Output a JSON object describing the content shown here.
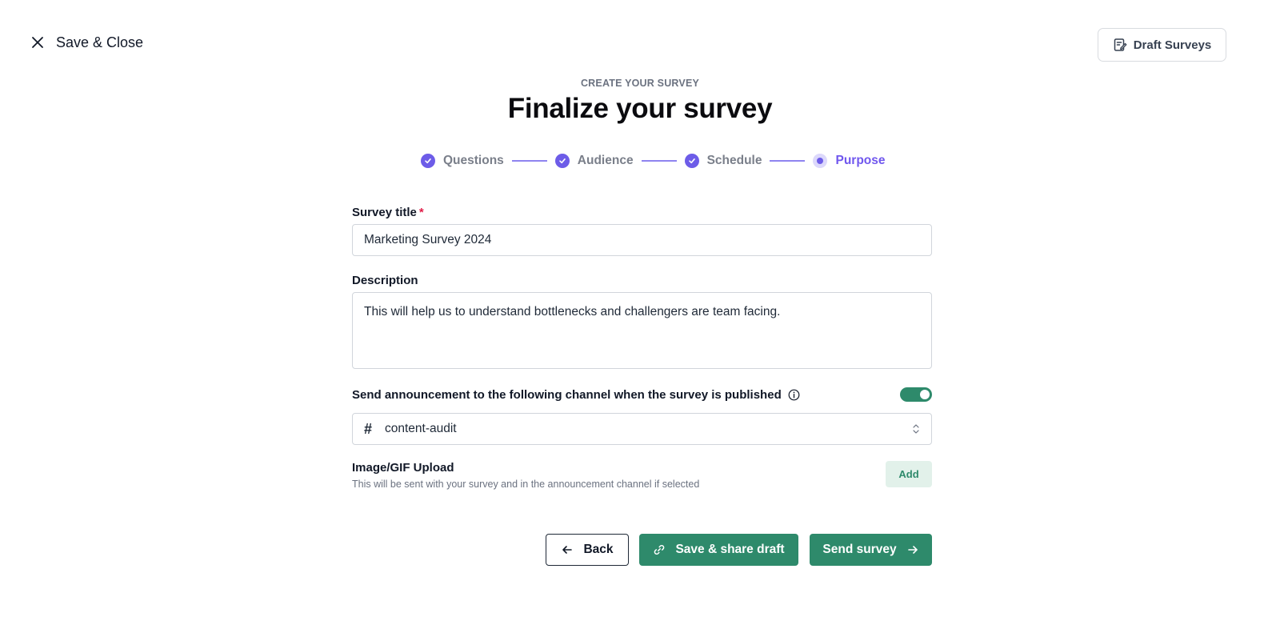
{
  "topbar": {
    "close_label": "Save & Close",
    "drafts_label": "Draft Surveys"
  },
  "header": {
    "eyebrow": "CREATE YOUR SURVEY",
    "title": "Finalize your survey"
  },
  "stepper": {
    "steps": [
      {
        "label": "Questions",
        "state": "done"
      },
      {
        "label": "Audience",
        "state": "done"
      },
      {
        "label": "Schedule",
        "state": "done"
      },
      {
        "label": "Purpose",
        "state": "current"
      }
    ]
  },
  "form": {
    "title_label": "Survey title",
    "title_required_mark": "*",
    "title_value": "Marketing Survey 2024",
    "description_label": "Description",
    "description_value": "This will help us to understand bottlenecks and challengers are team facing.",
    "announce_label": "Send announcement to the following channel when the survey is published",
    "announce_enabled": true,
    "channel_prefix": "#",
    "channel_value": "content-audit",
    "upload_title": "Image/GIF Upload",
    "upload_subtitle": "This will be sent with your survey and in the announcement channel if selected",
    "upload_button": "Add"
  },
  "actions": {
    "back": "Back",
    "save_share": "Save & share draft",
    "send": "Send survey"
  },
  "colors": {
    "accent_purple": "#6d5ce8",
    "primary_green": "#2e8a6b",
    "add_bg": "#e2f1ea"
  }
}
